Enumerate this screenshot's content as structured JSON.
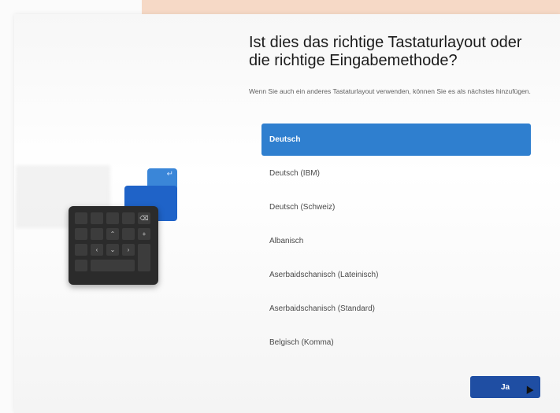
{
  "dialog": {
    "title_line1": "Ist dies das richtige Tastaturlayout oder",
    "title_line2": "die richtige Eingabemethode?",
    "subtitle": "Wenn Sie auch ein anderes Tastaturlayout verwenden, können Sie es als nächstes hinzufügen."
  },
  "layouts": [
    {
      "label": "Deutsch",
      "selected": true
    },
    {
      "label": "Deutsch (IBM)",
      "selected": false
    },
    {
      "label": "Deutsch (Schweiz)",
      "selected": false
    },
    {
      "label": "Albanisch",
      "selected": false
    },
    {
      "label": "Aserbaidschanisch (Lateinisch)",
      "selected": false
    },
    {
      "label": "Aserbaidschanisch (Standard)",
      "selected": false
    },
    {
      "label": "Belgisch (Komma)",
      "selected": false
    }
  ],
  "buttons": {
    "confirm_label": "Ja"
  },
  "illustration": {
    "icons": [
      "keyboard-numpad-icon",
      "enter-key-icon",
      "backspace-icon",
      "arrow-keys-icon"
    ],
    "accent_light": "#3a86d8",
    "accent_dark": "#1f63c8"
  },
  "colors": {
    "selection": "#2f7fcf",
    "button": "#1f4ea3"
  }
}
